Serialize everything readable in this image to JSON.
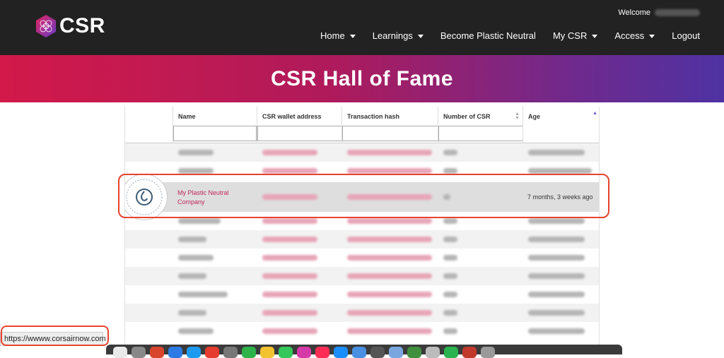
{
  "header": {
    "logo_text": "CSR",
    "welcome_label": "Welcome",
    "nav": [
      {
        "label": "Home",
        "dropdown": true
      },
      {
        "label": "Learnings",
        "dropdown": true
      },
      {
        "label": "Become Plastic Neutral",
        "dropdown": false
      },
      {
        "label": "My CSR",
        "dropdown": true
      },
      {
        "label": "Access",
        "dropdown": true
      },
      {
        "label": "Logout",
        "dropdown": false
      }
    ]
  },
  "banner": {
    "title": "CSR Hall of Fame"
  },
  "table": {
    "columns": [
      "Name",
      "CSR wallet address",
      "Transaction hash",
      "Number of CSR",
      "Age"
    ],
    "highlighted_row": {
      "name": "My Plastic Neutral Company",
      "age": "7 months, 3 weeks ago"
    }
  },
  "status_bar": {
    "url": "https://wwww.corsairnow.com"
  },
  "colors": {
    "accent": "#c0285f",
    "highlight_border": "#e8432e",
    "topbar": "#222222"
  }
}
